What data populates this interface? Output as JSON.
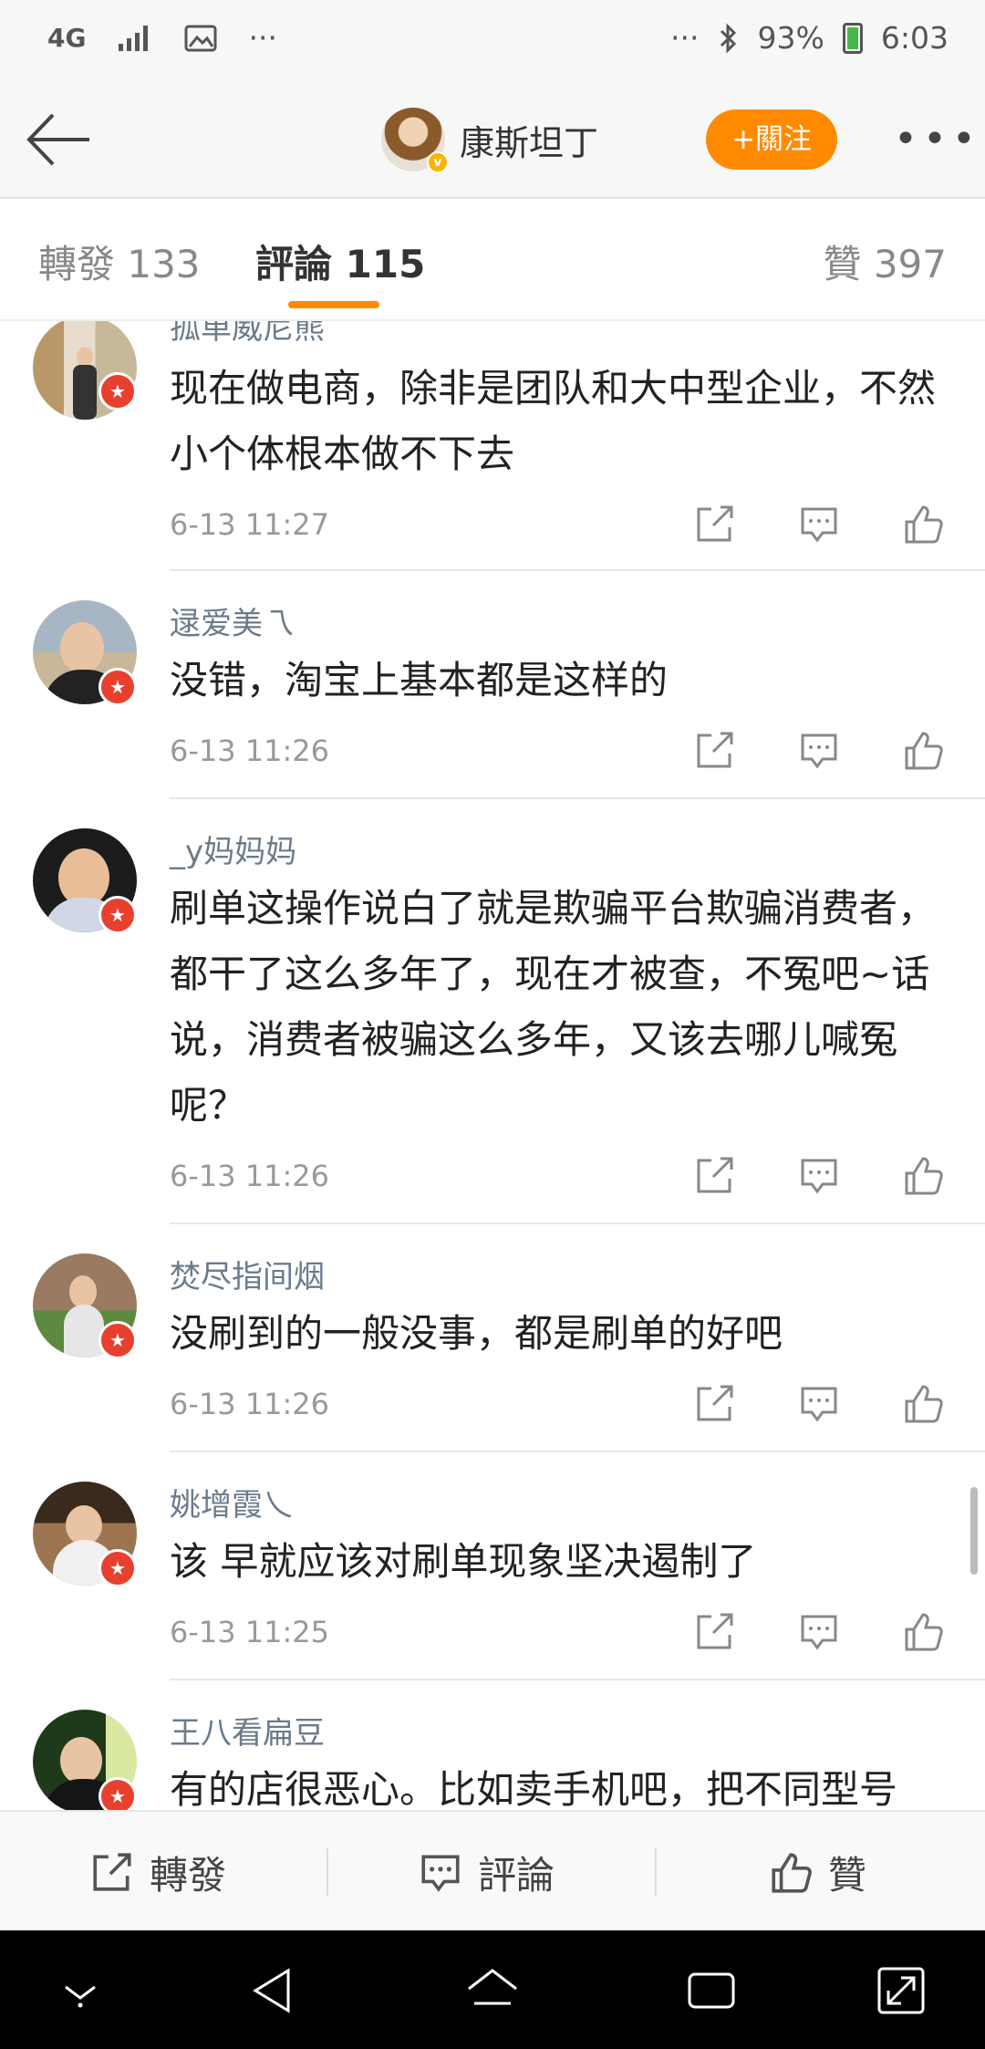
{
  "status_bar": {
    "network": "4G",
    "overflow_left": "···",
    "overflow_right": "···",
    "battery_percent": "93%",
    "time": "6:03"
  },
  "header": {
    "username": "康斯坦丁",
    "follow_label": "+關注",
    "more_label": "•••"
  },
  "tabs": {
    "repost": "轉發 133",
    "comments": "評論 115",
    "likes": "贊 397"
  },
  "comments": [
    {
      "name": "孤单威尼熊",
      "text": "现在做电商，除非是团队和大中型企业，不然小个体根本做不下去",
      "time": "6-13 11:27"
    },
    {
      "name": "逯爱美乁",
      "text": "没错，淘宝上基本都是这样的",
      "time": "6-13 11:26"
    },
    {
      "name": "_y妈妈妈",
      "text": "刷单这操作说白了就是欺骗平台欺骗消费者，都干了这么多年了，现在才被查，不冤吧~话说，消费者被骗这么多年，又该去哪儿喊冤呢？",
      "time": "6-13 11:26"
    },
    {
      "name": "焚尽指间烟",
      "text": "没刷到的一般没事，都是刷单的好吧",
      "time": "6-13 11:26"
    },
    {
      "name": "姚增霞乀",
      "text": "该 早就应该对刷单现象坚决遏制了",
      "time": "6-13 11:25"
    },
    {
      "name": "王八看扁豆",
      "text": "有的店很恶心。比如卖手机吧，把不同型号",
      "time": ""
    }
  ],
  "bottom_bar": {
    "repost": "轉發",
    "comment": "評論",
    "like": "贊"
  },
  "colors": {
    "accent": "#ff8a00",
    "name": "#6b7b8a",
    "badge": "#e8402f"
  }
}
